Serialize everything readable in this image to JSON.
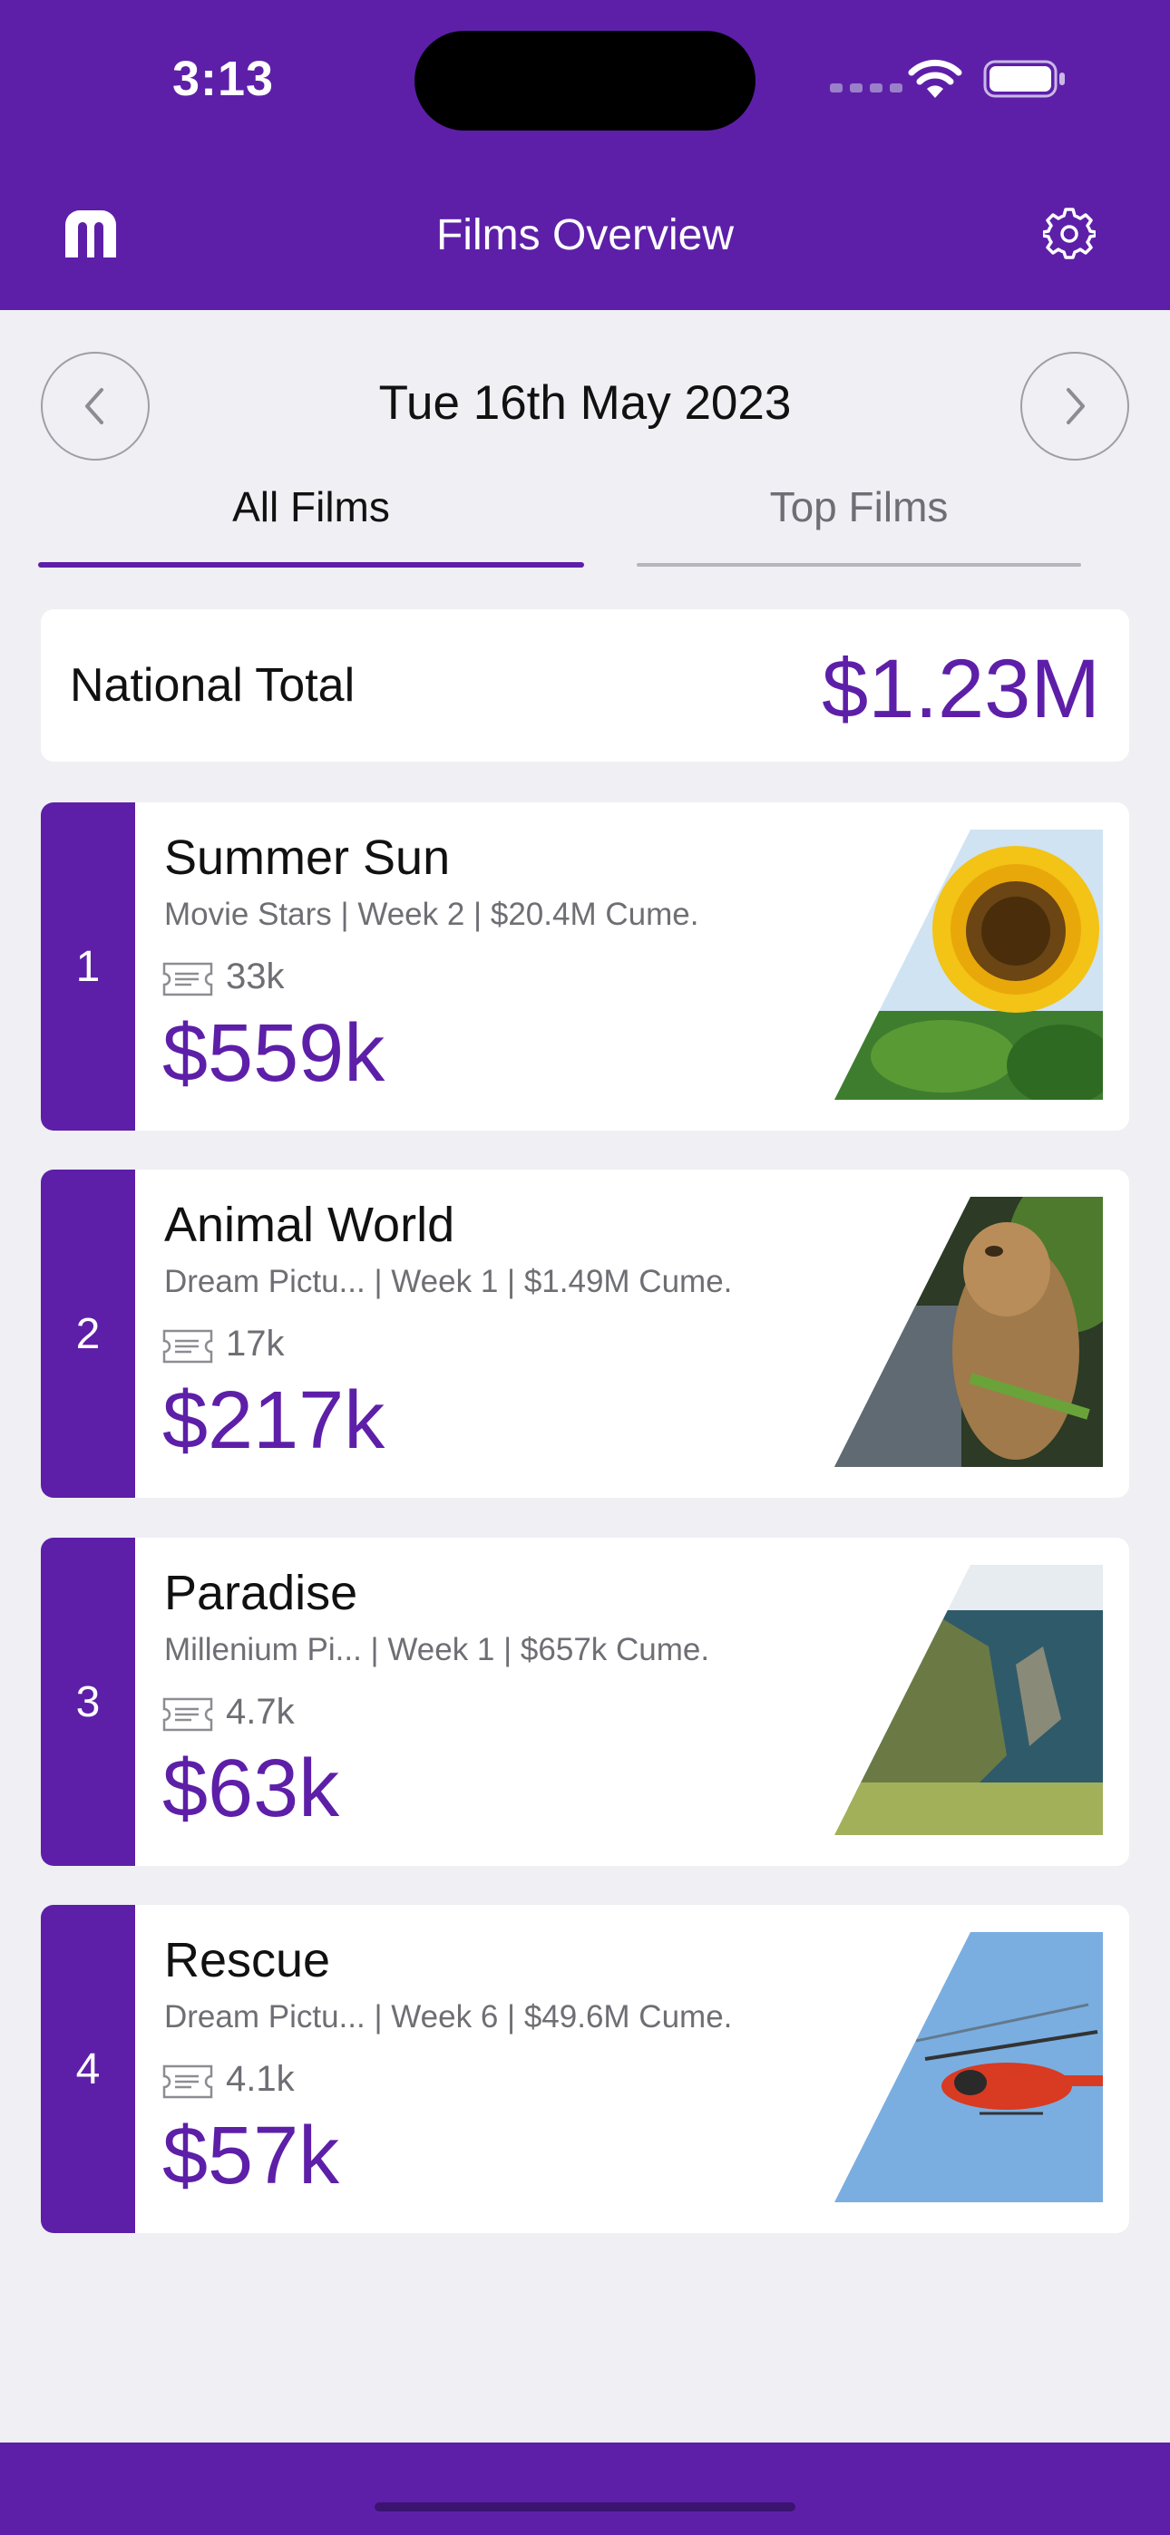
{
  "status_bar": {
    "time": "3:13"
  },
  "header": {
    "title": "Films Overview"
  },
  "date_nav": {
    "date": "Tue 16th May 2023"
  },
  "tabs": [
    {
      "label": "All Films"
    },
    {
      "label": "Top Films"
    }
  ],
  "national_total": {
    "label": "National Total",
    "value": "$1.23M"
  },
  "films": [
    {
      "rank": "1",
      "title": "Summer Sun",
      "subtitle": "Movie Stars | Week 2 | $20.4M Cume.",
      "admits": "33k",
      "gross": "$559k",
      "image": "sunflower-photo"
    },
    {
      "rank": "2",
      "title": "Animal World",
      "subtitle": "Dream Pictu... | Week 1 | $1.49M Cume.",
      "admits": "17k",
      "gross": "$217k",
      "image": "cat-photo"
    },
    {
      "rank": "3",
      "title": "Paradise",
      "subtitle": "Millenium Pi... | Week 1 | $657k Cume.",
      "admits": "4.7k",
      "gross": "$63k",
      "image": "coastline-photo"
    },
    {
      "rank": "4",
      "title": "Rescue",
      "subtitle": "Dream Pictu... | Week 6 | $49.6M Cume.",
      "admits": "4.1k",
      "gross": "$57k",
      "image": "helicopter-photo"
    }
  ],
  "colors": {
    "brand": "#5d1fa8",
    "background": "#efeff4"
  }
}
